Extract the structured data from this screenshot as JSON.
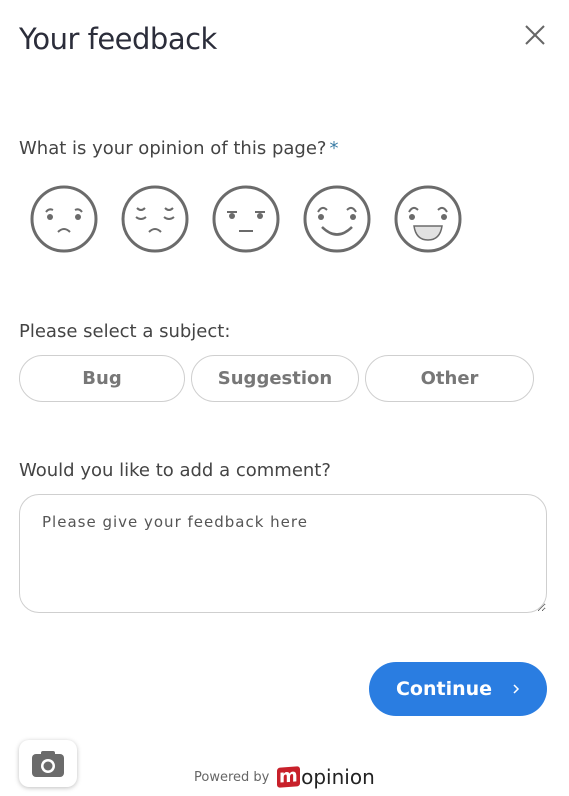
{
  "header": {
    "title": "Your feedback",
    "close_icon": "close-icon"
  },
  "rating": {
    "question": "What is your opinion of this page?",
    "required_marker": "*",
    "options": [
      {
        "name": "very-unhappy",
        "icon": "face-very-unhappy-icon"
      },
      {
        "name": "unhappy",
        "icon": "face-unhappy-icon"
      },
      {
        "name": "neutral",
        "icon": "face-neutral-icon"
      },
      {
        "name": "happy",
        "icon": "face-happy-icon"
      },
      {
        "name": "very-happy",
        "icon": "face-very-happy-icon"
      }
    ]
  },
  "subject": {
    "question": "Please select a subject:",
    "options": [
      "Bug",
      "Suggestion",
      "Other"
    ]
  },
  "comment": {
    "question": "Would you like to add a comment?",
    "placeholder": "Please give your feedback here",
    "value": ""
  },
  "actions": {
    "continue_label": "Continue",
    "continue_icon": "chevron-right-icon",
    "screenshot_icon": "camera-icon"
  },
  "footer": {
    "powered_by": "Powered by",
    "brand_m": "m",
    "brand_rest": "opinion"
  },
  "colors": {
    "accent": "#2a7de1",
    "brand": "#c8202a",
    "required": "#3a7ca5"
  }
}
